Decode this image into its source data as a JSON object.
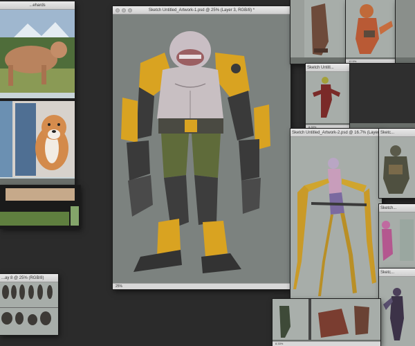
{
  "windows": {
    "main": {
      "title": "Sketch Untitled_Artwork-1.psd @ 25% (Layer 3, RGB/8) *",
      "zoom": "25%"
    },
    "second": {
      "title": "Sketch Untitled_Artwork-2.psd @ 16.7% (Layer 8, RGB/8) *",
      "zoom": "16.7%"
    },
    "small_sketch": {
      "title": "Sketch Untitl...",
      "zoom": "8.33%"
    },
    "photo_dogs": {
      "title": "...ehards"
    },
    "bottom_left": {
      "title": "...ay 8 @ 25% (RGB/8)"
    },
    "right_top_a": {
      "zoom": "12.5%"
    },
    "right_top_b": {
      "title": "Sketc..."
    },
    "right_mid": {
      "title": "Sketch..."
    },
    "right_bottom": {
      "title": "Sketc..."
    },
    "bottom_center": {
      "zoom": "8.33%"
    }
  },
  "colors": {
    "desktop": "#2b2b2b",
    "canvas_gray": "#7c827f",
    "armor_yellow": "#d9a321",
    "armor_dark": "#3a3a3a",
    "skin": "#c8bfc2",
    "pants_green": "#5f6b3a"
  }
}
